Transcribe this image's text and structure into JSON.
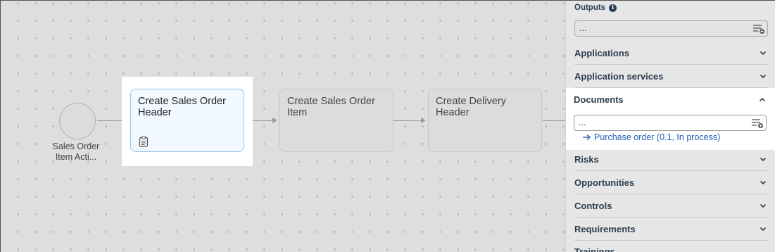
{
  "diagram": {
    "start_event": {
      "label": "Sales Order Item Acti..."
    },
    "tasks": [
      {
        "label": "Create Sales Order Header"
      },
      {
        "label": "Create Sales Order Item"
      },
      {
        "label": "Create Delivery Header"
      }
    ]
  },
  "panel": {
    "outputs": {
      "label": "Outputs",
      "value": "..."
    },
    "sections": {
      "applications": "Applications",
      "application_services": "Application services",
      "documents": "Documents",
      "risks": "Risks",
      "opportunities": "Opportunities",
      "controls": "Controls",
      "requirements": "Requirements",
      "trainings": "Trainings"
    },
    "documents": {
      "input_value": "...",
      "linked_item": "Purchase order (0.1, In process)"
    }
  },
  "colors": {
    "accent_link": "#1f5fb8",
    "selected_border": "#8fc1ec",
    "heading": "#2c3e50"
  }
}
